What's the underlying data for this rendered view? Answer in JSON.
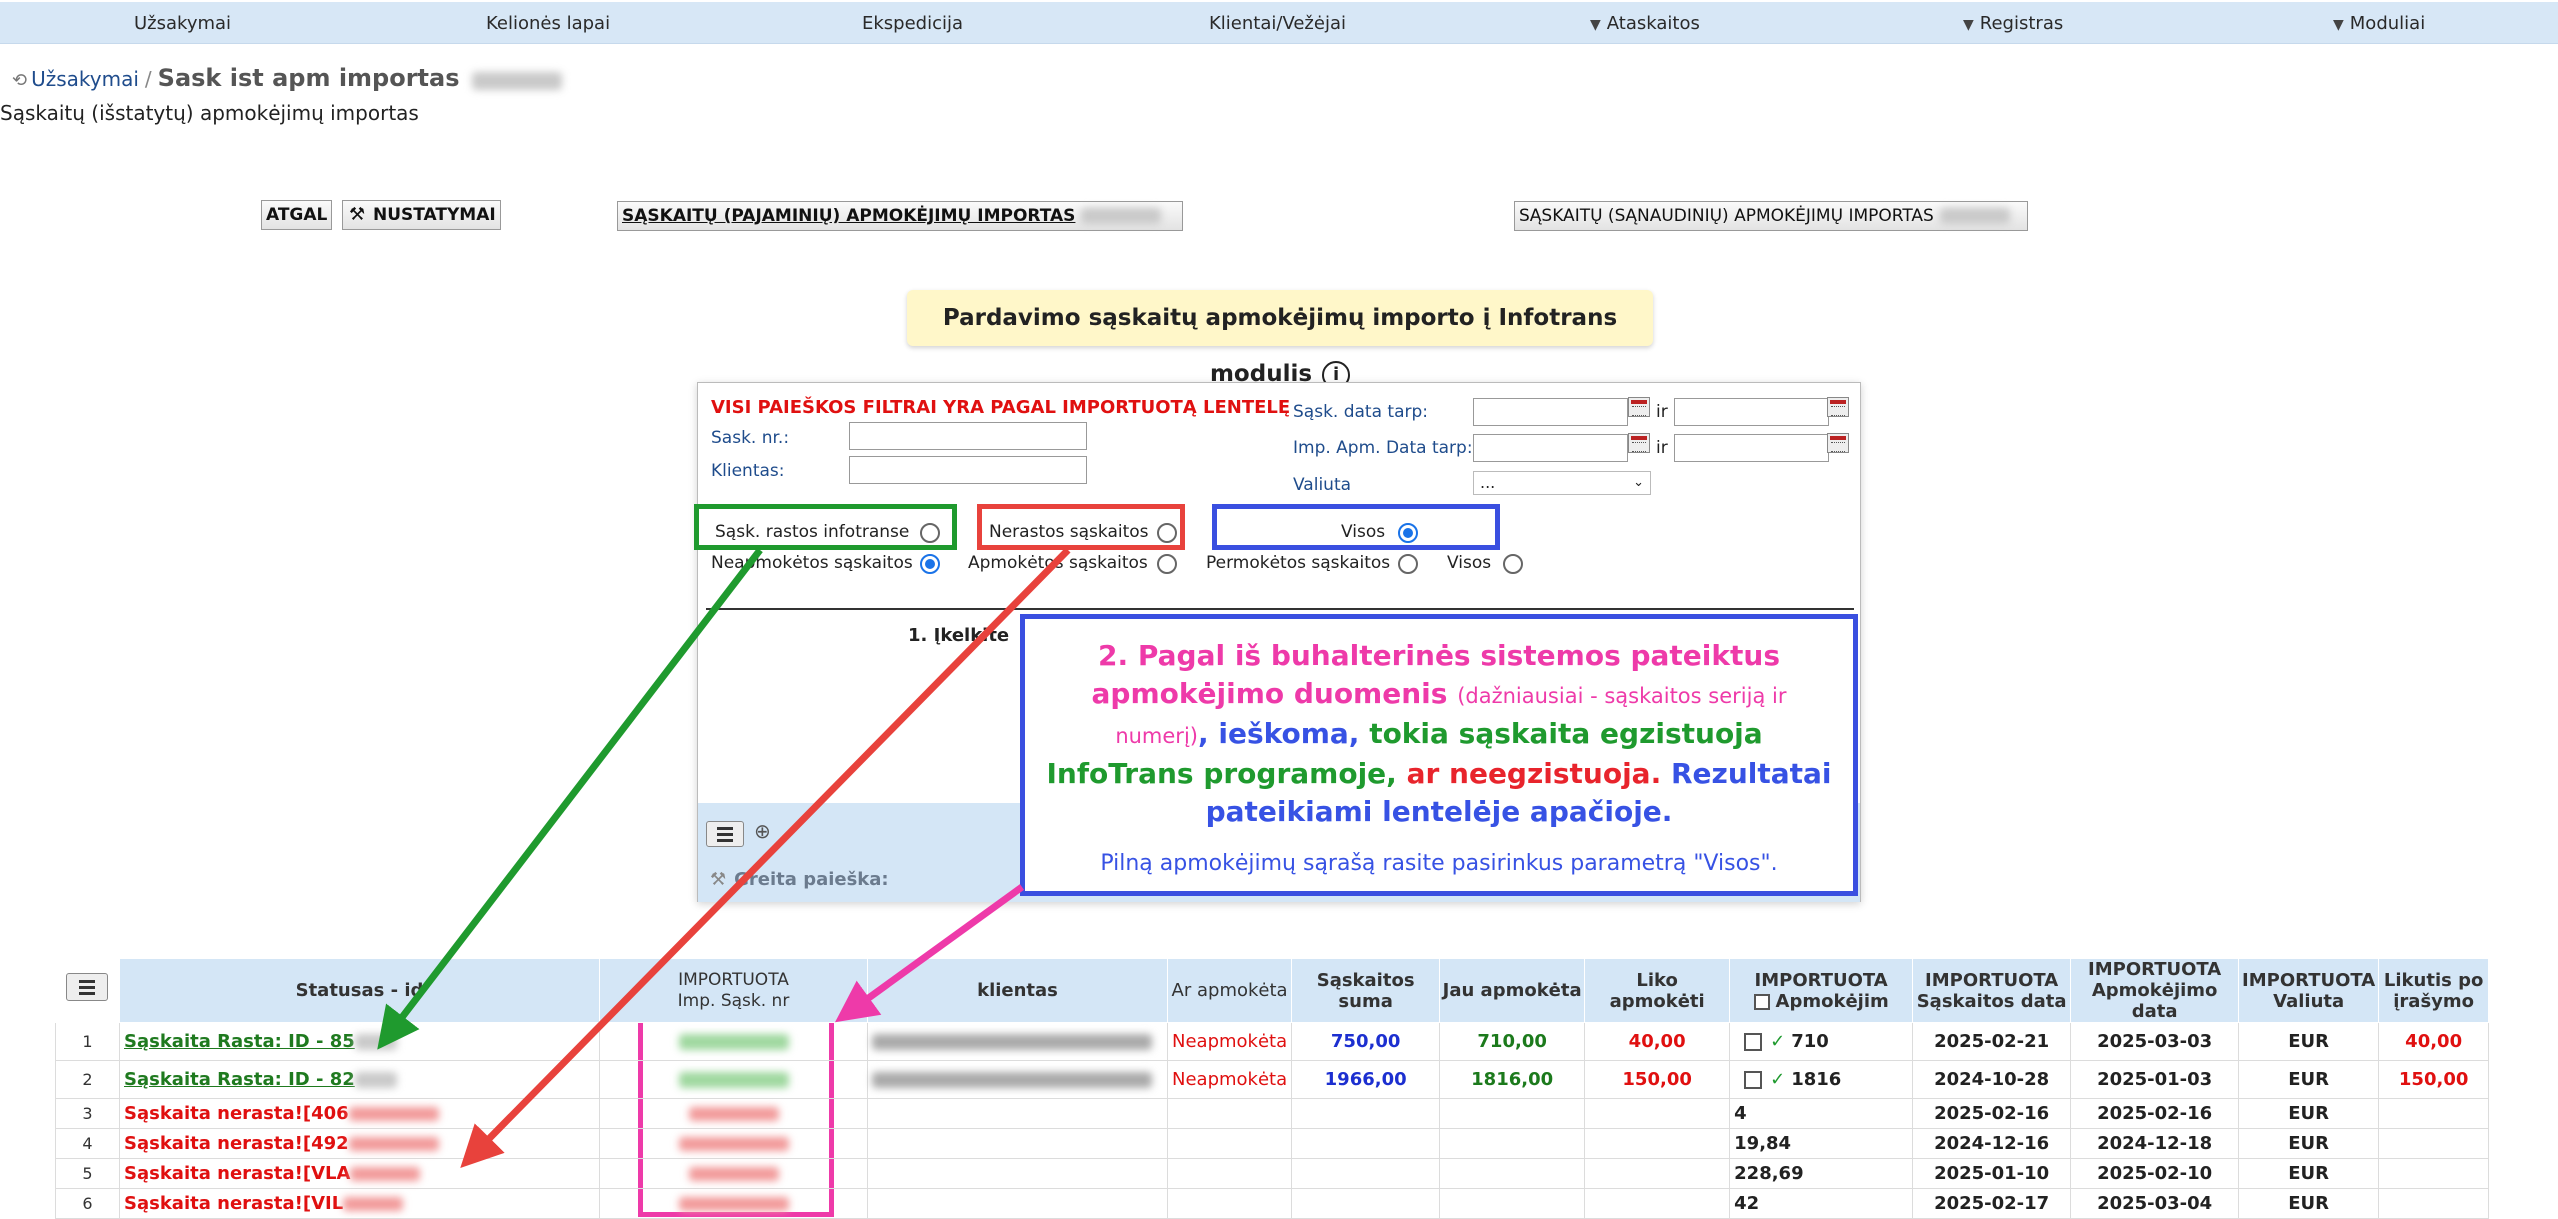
{
  "nav": {
    "items": [
      {
        "label": "Užsakymai",
        "dropdown": false
      },
      {
        "label": "Kelionės lapai",
        "dropdown": false
      },
      {
        "label": "Ekspedicija",
        "dropdown": false
      },
      {
        "label": "Klientai/Vežėjai",
        "dropdown": false
      },
      {
        "label": "Ataskaitos",
        "dropdown": true
      },
      {
        "label": "Registras",
        "dropdown": true
      },
      {
        "label": "Moduliai",
        "dropdown": true
      }
    ],
    "dropdown_glyph": "▼"
  },
  "breadcrumb": {
    "home": "Užsakymai",
    "separator": "/",
    "current": "Sask ist apm importas"
  },
  "page_subtitle": "Sąskaitų (išstatytų) apmokėjimų importas",
  "toolbar": {
    "back": "ATGAL",
    "settings": "NUSTATYMAI",
    "income_import": "SĄSKAITŲ (PAJAMINIŲ) APMOKĖJIMŲ IMPORTAS",
    "expense_import": "SĄSKAITŲ (SĄNAUDINIŲ) APMOKĖJIMŲ IMPORTAS"
  },
  "info_banner": {
    "text": "Pardavimo sąskaitų apmokėjimų importo į Infotrans modulis",
    "icon_glyph": "i"
  },
  "filters": {
    "title": "VISI PAIEŠKOS FILTRAI YRA PAGAL IMPORTUOTĄ LENTELĘ",
    "invoice_no_label": "Sask. nr.:",
    "client_label": "Klientas:",
    "invoice_date_label": "Sąsk. data tarp:",
    "payment_date_label": "Imp. Apm. Data tarp:",
    "currency_label": "Valiuta",
    "currency_value": "...",
    "and_label": "ir",
    "radio_row1": [
      {
        "label": "Sąsk. rastos infotranse",
        "selected": false
      },
      {
        "label": "Nerastos sąskaitos",
        "selected": false
      },
      {
        "label": "Visos",
        "selected": true
      }
    ],
    "radio_row2": [
      {
        "label": "Neapmokėtos sąskaitos",
        "selected": true
      },
      {
        "label": "Apmokėtos sąskaitos",
        "selected": false
      },
      {
        "label": "Permokėtos sąskaitos",
        "selected": false
      },
      {
        "label": "Visos",
        "selected": false
      }
    ],
    "step1": "1. Įkelkite",
    "quick_search": "Greita paieška:"
  },
  "callout": {
    "p1": "2. Pagal iš buhalterinės sistemos pateiktus apmokėjimo duomenis",
    "p1_small": "(dažniausiai - sąskaitos seriją ir numerį)",
    "p2": ", ieškoma,",
    "p3": "tokia sąskaita egzistuoja InfoTrans programoje,",
    "p4": "ar neegzistuoja.",
    "p5": "Rezultatai pateikiami lentelėje apačioje.",
    "note": "Pilną apmokėjimų sąrašą rasite pasirinkus parametrą \"Visos\"."
  },
  "annotation_colors": {
    "green": "#1f9a2e",
    "red": "#e8423c",
    "blue": "#3a4fe0",
    "magenta": "#ee3aa9"
  },
  "table": {
    "headers": {
      "status": "Statusas - id",
      "imp_no_1": "IMPORTUOTA",
      "imp_no_2": "Imp. Sąsk. nr",
      "client": "klientas",
      "paid": "Ar apmokėta",
      "sum": "Sąskaitos suma",
      "already_paid": "Jau apmokėta",
      "left": "Liko apmokėti",
      "imp_paid_1": "IMPORTUOTA",
      "imp_paid_2": "Apmokėjim",
      "imp_date_1": "IMPORTUOTA",
      "imp_date_2": "Sąskaitos data",
      "imp_pay_date_1": "IMPORTUOTA",
      "imp_pay_date_2": "Apmokėjimo data",
      "imp_cur_1": "IMPORTUOTA",
      "imp_cur_2": "Valiuta",
      "rest_1": "Likutis po",
      "rest_2": "įrašymo"
    },
    "rows": [
      {
        "n": "1",
        "status": "Sąskaita Rasta: ID - 85",
        "found": true,
        "paid": "Neapmokėta",
        "sum": "750,00",
        "already": "710,00",
        "left": "40,00",
        "imp_paid": "710",
        "imp_date": "2025-02-21",
        "pay_date": "2025-03-03",
        "cur": "EUR",
        "rest": "40,00"
      },
      {
        "n": "2",
        "status": "Sąskaita Rasta: ID - 82",
        "found": true,
        "paid": "Neapmokėta",
        "sum": "1966,00",
        "already": "1816,00",
        "left": "150,00",
        "imp_paid": "1816",
        "imp_date": "2024-10-28",
        "pay_date": "2025-01-03",
        "cur": "EUR",
        "rest": "150,00"
      },
      {
        "n": "3",
        "status": "Sąskaita nerasta![406",
        "found": false,
        "imp_paid": "4",
        "imp_date": "2025-02-16",
        "pay_date": "2025-02-16",
        "cur": "EUR"
      },
      {
        "n": "4",
        "status": "Sąskaita nerasta![492",
        "found": false,
        "imp_paid": "19,84",
        "imp_date": "2024-12-16",
        "pay_date": "2024-12-18",
        "cur": "EUR"
      },
      {
        "n": "5",
        "status": "Sąskaita nerasta![VLA",
        "found": false,
        "imp_paid": "228,69",
        "imp_date": "2025-01-10",
        "pay_date": "2025-02-10",
        "cur": "EUR"
      },
      {
        "n": "6",
        "status": "Sąskaita nerasta![VIL",
        "found": false,
        "imp_paid": "42",
        "imp_date": "2025-02-17",
        "pay_date": "2025-03-04",
        "cur": "EUR"
      }
    ]
  }
}
